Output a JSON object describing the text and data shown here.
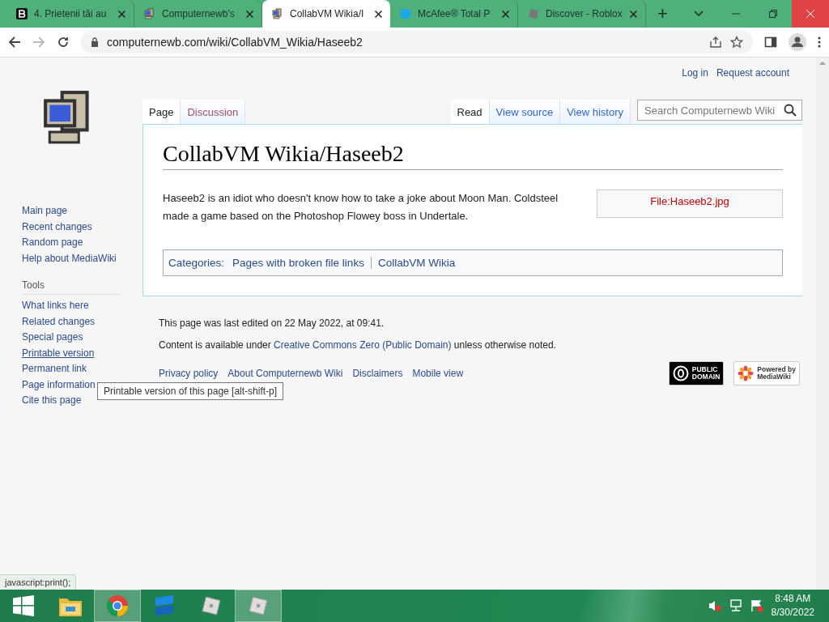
{
  "browser": {
    "tabs": [
      {
        "title": "4. Prietenii tăi au",
        "selected": false,
        "kind": "b"
      },
      {
        "title": "Computernewb's",
        "selected": false,
        "kind": "pc"
      },
      {
        "title": "CollabVM Wikia/I",
        "selected": true,
        "kind": "pc"
      },
      {
        "title": "McAfee® Total P",
        "selected": false,
        "kind": "shield"
      },
      {
        "title": "Discover - Roblox",
        "selected": false,
        "kind": "roblox"
      }
    ],
    "new_tab": "+",
    "url": "computernewb.com/wiki/CollabVM_Wikia/Haseeb2"
  },
  "personal": [
    "Log in",
    "Request account"
  ],
  "sidebar": {
    "nav": [
      "Main page",
      "Recent changes",
      "Random page",
      "Help about MediaWiki"
    ],
    "tools_heading": "Tools",
    "tools": [
      "What links here",
      "Related changes",
      "Special pages",
      "Printable version",
      "Permanent link",
      "Page information",
      "Cite this page"
    ]
  },
  "left_tabs": [
    {
      "label": "Page",
      "selected": true
    },
    {
      "label": "Discussion",
      "selected": false
    }
  ],
  "right_tabs": [
    {
      "label": "Read",
      "selected": true
    },
    {
      "label": "View source",
      "selected": false
    },
    {
      "label": "View history",
      "selected": false
    }
  ],
  "search": {
    "placeholder": "Search Computernewb Wiki"
  },
  "article": {
    "title": "CollabVM Wikia/Haseeb2",
    "text": "Haseeb2 is an idiot who doesn't know how to take a joke about Moon Man. Coldsteel made a game based on the Photoshop Flowey boss in Undertale.",
    "file_link": "File:Haseeb2.jpg",
    "categories_label": "Categories:",
    "categories": [
      "Pages with broken file links",
      "CollabVM Wikia"
    ]
  },
  "footer": {
    "last_edited": "This page was last edited on 22 May 2022, at 09:41.",
    "license_before": "Content is available under ",
    "license_link": "Creative Commons Zero (Public Domain)",
    "license_after": " unless otherwise noted.",
    "links": [
      "Privacy policy",
      "About Computernewb Wiki",
      "Disclaimers",
      "Mobile view"
    ],
    "badges": [
      {
        "kind": "pd",
        "lines": [
          "PUBLIC",
          "DOMAIN"
        ]
      },
      {
        "kind": "mw",
        "lines": [
          "Powered by",
          "MediaWiki"
        ]
      }
    ]
  },
  "tooltip": "Printable version of this page [alt-shift-p]",
  "status_url": "javascript:print();",
  "taskbar": {
    "apps": [
      {
        "kind": "folder",
        "selected": false
      },
      {
        "kind": "chrome",
        "selected": true
      },
      {
        "kind": "blue",
        "selected": false
      },
      {
        "kind": "roblox",
        "selected": false
      },
      {
        "kind": "roblox",
        "selected": true
      }
    ],
    "time": "8:48 AM",
    "date": "8/30/2022"
  }
}
